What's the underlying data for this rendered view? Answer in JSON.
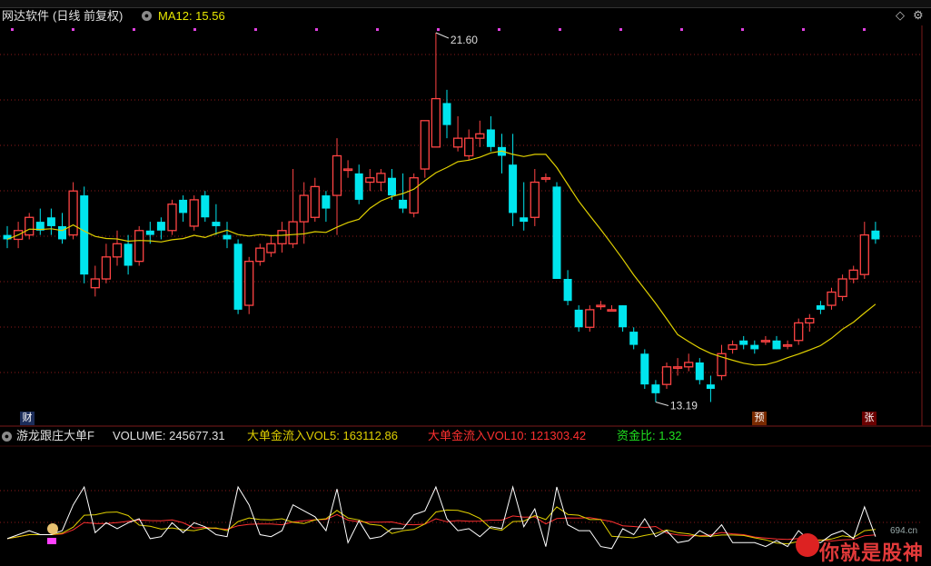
{
  "header": {
    "app_title": "网达软件",
    "period": "(日线 前复权)",
    "ma_label": "MA12: 15.56",
    "collapse_icon": "collapse-circle-icon"
  },
  "controls": {
    "diamond_icon": "diamond-icon",
    "gear_icon": "gear-icon"
  },
  "price_chart": {
    "high_label": "21.60",
    "low_label": "13.19",
    "badges": {
      "cai": "财",
      "yu": "预",
      "zhang": "张"
    }
  },
  "indicator": {
    "name": "游龙跟庄大单F",
    "volume": "VOLUME: 245677.31",
    "vol5": "大单金流入VOL5: 163112.86",
    "vol10": "大单金流入VOL10: 121303.42",
    "ratio": "资金比: 1.32"
  },
  "watermark": {
    "text": "你就是股神",
    "url": "694.cn"
  },
  "colors": {
    "up": "#ff4444",
    "down": "#00e5ee",
    "ma": "#e0d000",
    "bg": "#000000",
    "grid": "#8b1a1a"
  },
  "chart_data": {
    "type": "candlestick",
    "ohlc": [
      [
        17.0,
        17.2,
        16.7,
        16.9
      ],
      [
        16.9,
        17.3,
        16.7,
        17.1
      ],
      [
        17.0,
        17.5,
        16.9,
        17.4
      ],
      [
        17.3,
        17.6,
        17.0,
        17.1
      ],
      [
        17.4,
        17.6,
        17.0,
        17.2
      ],
      [
        17.2,
        17.5,
        16.8,
        16.9
      ],
      [
        17.0,
        18.2,
        16.9,
        18.0
      ],
      [
        17.9,
        18.1,
        15.9,
        16.1
      ],
      [
        15.8,
        16.3,
        15.6,
        16.0
      ],
      [
        16.0,
        16.8,
        15.9,
        16.5
      ],
      [
        16.5,
        17.1,
        16.3,
        16.8
      ],
      [
        16.8,
        17.0,
        16.1,
        16.3
      ],
      [
        16.4,
        17.2,
        16.3,
        17.1
      ],
      [
        17.1,
        17.3,
        16.8,
        17.0
      ],
      [
        17.3,
        17.4,
        16.9,
        17.1
      ],
      [
        17.1,
        17.8,
        17.0,
        17.7
      ],
      [
        17.8,
        17.9,
        17.3,
        17.5
      ],
      [
        17.2,
        17.9,
        17.1,
        17.8
      ],
      [
        17.9,
        18.0,
        17.3,
        17.4
      ],
      [
        17.3,
        17.7,
        17.0,
        17.2
      ],
      [
        17.0,
        17.3,
        16.7,
        16.9
      ],
      [
        16.8,
        16.9,
        15.2,
        15.3
      ],
      [
        15.4,
        16.5,
        15.2,
        16.4
      ],
      [
        16.4,
        16.8,
        16.3,
        16.7
      ],
      [
        16.6,
        17.0,
        16.5,
        16.8
      ],
      [
        16.8,
        17.3,
        16.6,
        17.1
      ],
      [
        16.8,
        18.5,
        16.7,
        17.3
      ],
      [
        17.3,
        18.2,
        16.8,
        17.9
      ],
      [
        17.4,
        18.3,
        17.3,
        18.1
      ],
      [
        17.9,
        18.0,
        17.3,
        17.6
      ],
      [
        17.9,
        19.2,
        17.0,
        18.8
      ],
      [
        18.5,
        18.7,
        18.3,
        18.5
      ],
      [
        18.4,
        18.6,
        17.7,
        17.8
      ],
      [
        18.2,
        18.5,
        18.0,
        18.3
      ],
      [
        18.2,
        18.5,
        18.0,
        18.4
      ],
      [
        18.3,
        18.5,
        17.8,
        17.9
      ],
      [
        17.8,
        18.4,
        17.5,
        17.6
      ],
      [
        17.5,
        18.4,
        17.4,
        18.3
      ],
      [
        18.5,
        19.2,
        18.3,
        19.6
      ],
      [
        19.0,
        21.6,
        19.0,
        20.1
      ],
      [
        20.0,
        20.3,
        19.2,
        19.5
      ],
      [
        19.0,
        19.7,
        18.9,
        19.2
      ],
      [
        18.8,
        19.4,
        18.7,
        19.2
      ],
      [
        19.2,
        19.6,
        19.0,
        19.3
      ],
      [
        19.4,
        19.7,
        18.9,
        19.0
      ],
      [
        19.0,
        19.3,
        18.4,
        18.8
      ],
      [
        18.6,
        19.3,
        17.2,
        17.5
      ],
      [
        17.4,
        18.2,
        17.1,
        17.3
      ],
      [
        17.4,
        18.5,
        17.2,
        18.2
      ],
      [
        18.3,
        18.4,
        18.2,
        18.3
      ],
      [
        18.1,
        18.2,
        16.0,
        16.0
      ],
      [
        16.0,
        16.2,
        15.4,
        15.5
      ],
      [
        15.3,
        15.4,
        14.8,
        14.9
      ],
      [
        14.9,
        15.4,
        14.8,
        15.3
      ],
      [
        15.4,
        15.5,
        15.3,
        15.4
      ],
      [
        15.3,
        15.4,
        15.3,
        15.3
      ],
      [
        15.4,
        15.4,
        14.8,
        14.9
      ],
      [
        14.8,
        14.9,
        14.4,
        14.5
      ],
      [
        14.3,
        14.4,
        13.5,
        13.6
      ],
      [
        13.6,
        13.7,
        13.2,
        13.4
      ],
      [
        13.6,
        14.1,
        13.5,
        14.0
      ],
      [
        14.0,
        14.2,
        13.8,
        14.0
      ],
      [
        14.0,
        14.3,
        13.9,
        14.1
      ],
      [
        14.1,
        14.2,
        13.6,
        13.7
      ],
      [
        13.6,
        13.8,
        13.2,
        13.5
      ],
      [
        13.8,
        14.5,
        13.7,
        14.3
      ],
      [
        14.4,
        14.6,
        14.3,
        14.5
      ],
      [
        14.6,
        14.7,
        14.4,
        14.5
      ],
      [
        14.5,
        14.6,
        14.3,
        14.4
      ],
      [
        14.6,
        14.7,
        14.5,
        14.6
      ],
      [
        14.6,
        14.7,
        14.4,
        14.4
      ],
      [
        14.5,
        14.6,
        14.4,
        14.5
      ],
      [
        14.6,
        15.1,
        14.5,
        15.0
      ],
      [
        15.0,
        15.2,
        14.8,
        15.1
      ],
      [
        15.4,
        15.5,
        15.2,
        15.3
      ],
      [
        15.4,
        15.8,
        15.3,
        15.7
      ],
      [
        15.6,
        16.1,
        15.5,
        16.0
      ],
      [
        16.0,
        16.3,
        15.9,
        16.2
      ],
      [
        16.1,
        17.3,
        16.0,
        17.0
      ],
      [
        17.1,
        17.3,
        16.8,
        16.9
      ]
    ],
    "ma12_series_label": "MA12",
    "volume_panel": {
      "series": [
        {
          "name": "VOLUME",
          "color": "#ffffff"
        },
        {
          "name": "大单金流入VOL5",
          "color": "#e0d000"
        },
        {
          "name": "大单金流入VOL10",
          "color": "#ff3030"
        }
      ],
      "last": {
        "VOLUME": 245677.31,
        "VOL5": 163112.86,
        "VOL10": 121303.42,
        "ratio": 1.32
      }
    }
  }
}
